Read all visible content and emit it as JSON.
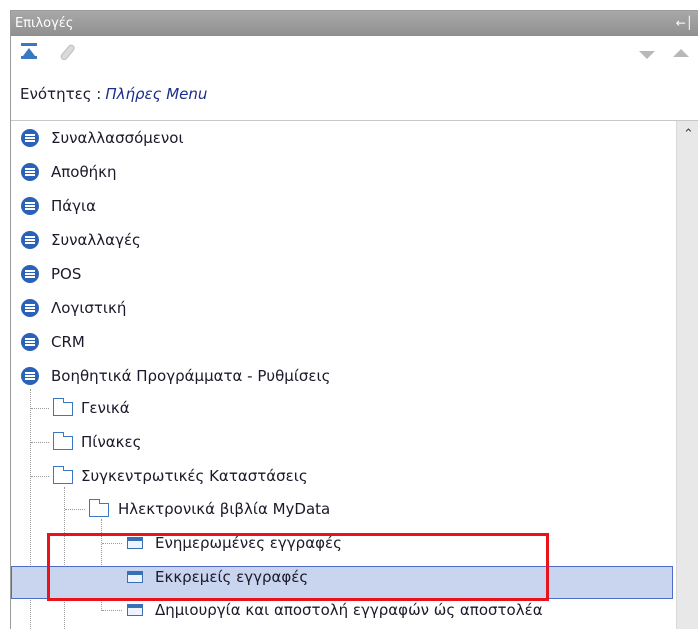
{
  "panel": {
    "title": "Επιλογές",
    "pin_icon": "pin-icon"
  },
  "toolbar": {
    "collapse_icon": "collapse-all-icon",
    "clip_icon": "attachment-icon",
    "down_icon": "arrow-down-icon",
    "up_icon": "arrow-up-icon"
  },
  "sections": {
    "label": "Ενότητες :",
    "value": "Πλήρες Menu"
  },
  "menu": {
    "items": [
      {
        "label": "Συναλλασσόμενοι"
      },
      {
        "label": "Αποθήκη"
      },
      {
        "label": "Πάγια"
      },
      {
        "label": "Συναλλαγές"
      },
      {
        "label": "POS"
      },
      {
        "label": "Λογιστική"
      },
      {
        "label": "CRM"
      },
      {
        "label": "Βοηθητικά Προγράμματα - Ρυθμίσεις"
      }
    ],
    "sub": {
      "general": "Γενικά",
      "tables": "Πίνακες",
      "summary": "Συγκεντρωτικές Καταστάσεις",
      "mydata": "Ηλεκτρονικά βιβλία MyData",
      "updated": "Ενημερωμένες εγγραφές",
      "pending": "Εκκρεμείς εγγραφές",
      "create_send": "Δημιουργία και αποστολή εγγραφών ώς αποστολέα"
    }
  },
  "colors": {
    "accent": "#2a62b8",
    "selection": "#c9d4ef",
    "highlight_box": "#e8131b"
  }
}
